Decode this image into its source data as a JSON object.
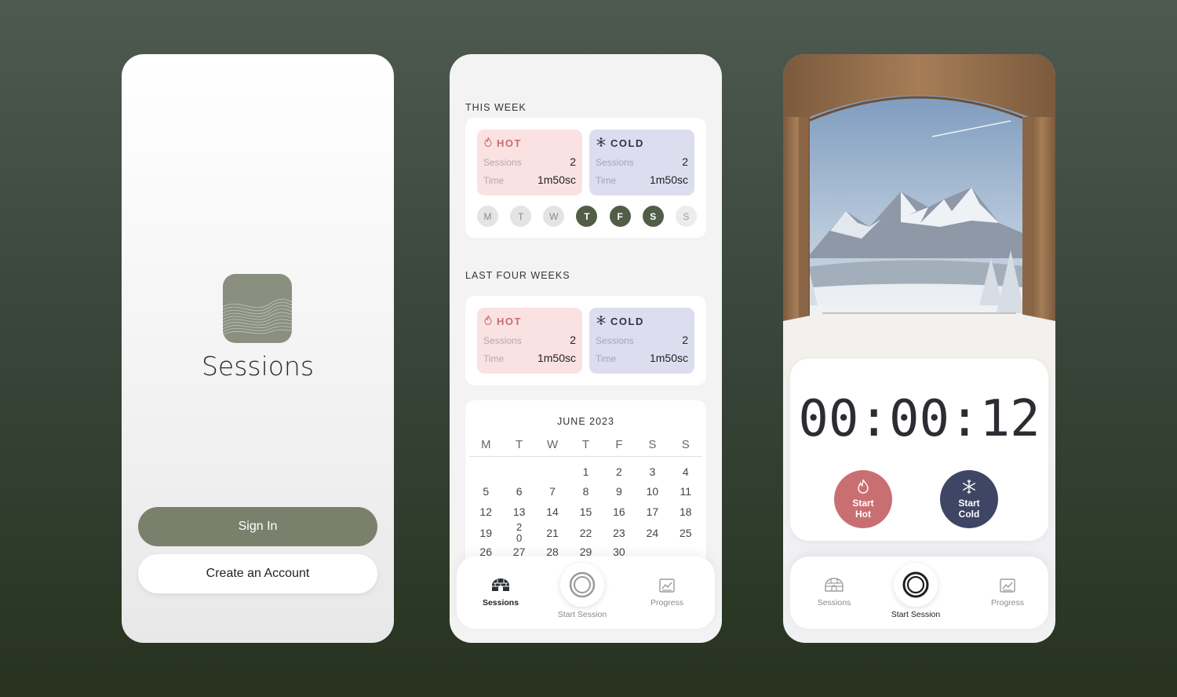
{
  "welcome": {
    "app_name": "Sessions",
    "sign_in_label": "Sign In",
    "create_account_label": "Create an Account"
  },
  "dashboard": {
    "this_week": {
      "title": "THIS WEEK",
      "hot": {
        "label": "HOT",
        "sessions_label": "Sessions",
        "sessions": "2",
        "time_label": "Time",
        "time": "1m50sc"
      },
      "cold": {
        "label": "COLD",
        "sessions_label": "Sessions",
        "sessions": "2",
        "time_label": "Time",
        "time": "1m50sc"
      },
      "days": [
        {
          "letter": "M",
          "state": "off"
        },
        {
          "letter": "T",
          "state": "off"
        },
        {
          "letter": "W",
          "state": "off"
        },
        {
          "letter": "T",
          "state": "on"
        },
        {
          "letter": "F",
          "state": "on"
        },
        {
          "letter": "S",
          "state": "on"
        },
        {
          "letter": "S",
          "state": "dim"
        }
      ]
    },
    "last_four_weeks": {
      "title": "LAST FOUR WEEKS",
      "hot": {
        "label": "HOT",
        "sessions_label": "Sessions",
        "sessions": "2",
        "time_label": "Time",
        "time": "1m50sc"
      },
      "cold": {
        "label": "COLD",
        "sessions_label": "Sessions",
        "sessions": "2",
        "time_label": "Time",
        "time": "1m50sc"
      }
    },
    "calendar": {
      "title": "JUNE 2023",
      "weekdays": [
        "M",
        "T",
        "W",
        "T",
        "F",
        "S",
        "S"
      ],
      "weeks": [
        [
          "",
          "",
          "",
          "1",
          "2",
          "3",
          "4"
        ],
        [
          "5",
          "6",
          "7",
          "8",
          "9",
          "10",
          "11"
        ],
        [
          "12",
          "13",
          "14",
          "15",
          "16",
          "17",
          "18"
        ],
        [
          "19",
          "2\n0",
          "21",
          "22",
          "23",
          "24",
          "25"
        ],
        [
          "26",
          "27",
          "28",
          "29",
          "30",
          "",
          ""
        ]
      ]
    }
  },
  "nav": {
    "sessions_label": "Sessions",
    "start_session_label": "Start Session",
    "progress_label": "Progress"
  },
  "timer_screen": {
    "timer_value": "00:00:12",
    "start_hot_label_1": "Start",
    "start_hot_label_2": "Hot",
    "start_cold_label_1": "Start",
    "start_cold_label_2": "Cold"
  },
  "colors": {
    "accent_green": "#7b806d",
    "hot_bg": "#fbe2e2",
    "cold_bg": "#dcdeef",
    "hot_button": "#c96f72",
    "cold_button": "#3f4564",
    "active_day": "#515d47"
  },
  "icons": {
    "hot": "flame-icon",
    "cold": "snowflake-icon",
    "sessions": "igloo-icon",
    "start_session": "ring-icon",
    "progress": "chart-icon"
  }
}
